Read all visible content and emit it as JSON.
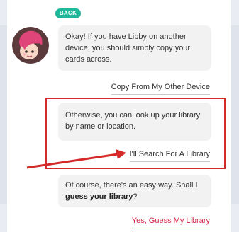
{
  "header": {
    "back_label": "BACK"
  },
  "chat": {
    "message1": "Okay! If you have Libby on another device, you should simply copy your cards across.",
    "action1": "Copy From My Other Device",
    "message2": "Otherwise, you can look up your library by name or location.",
    "action2": "I'll Search For A Library",
    "message3_prefix": "Of course, there's an easy way. Shall I",
    "message3_bold": "guess your library",
    "message3_suffix": "?",
    "action3": "Yes, Guess My Library"
  },
  "colors": {
    "accent_teal": "#1fb89a",
    "accent_red": "#d6264b",
    "highlight_red": "#d42a2a",
    "bubble": "#f2f2f2"
  }
}
